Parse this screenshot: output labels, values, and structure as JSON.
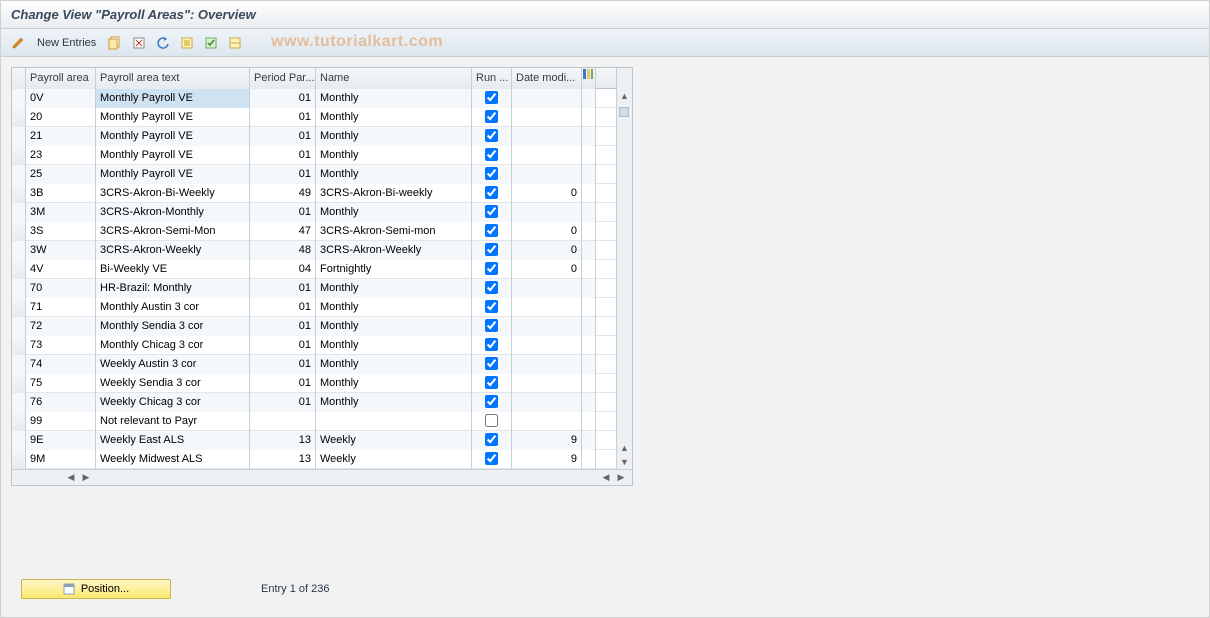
{
  "title": "Change View \"Payroll Areas\": Overview",
  "watermark": "www.tutorialkart.com",
  "toolbar": {
    "new_entries_label": "New Entries"
  },
  "columns": {
    "area": "Payroll area",
    "text": "Payroll area text",
    "period": "Period Par...",
    "name": "Name",
    "run": "Run ...",
    "date": "Date modi..."
  },
  "rows": [
    {
      "area": "0V",
      "text": "Monthly Payroll  VE",
      "period": "01",
      "name": "Monthly",
      "run": true,
      "date": ""
    },
    {
      "area": "20",
      "text": "Monthly Payroll  VE",
      "period": "01",
      "name": "Monthly",
      "run": true,
      "date": ""
    },
    {
      "area": "21",
      "text": "Monthly Payroll  VE",
      "period": "01",
      "name": "Monthly",
      "run": true,
      "date": ""
    },
    {
      "area": "23",
      "text": "Monthly Payroll  VE",
      "period": "01",
      "name": "Monthly",
      "run": true,
      "date": ""
    },
    {
      "area": "25",
      "text": "Monthly Payroll  VE",
      "period": "01",
      "name": "Monthly",
      "run": true,
      "date": ""
    },
    {
      "area": "3B",
      "text": "3CRS-Akron-Bi-Weekly",
      "period": "49",
      "name": "3CRS-Akron-Bi-weekly",
      "run": true,
      "date": "0"
    },
    {
      "area": "3M",
      "text": "3CRS-Akron-Monthly",
      "period": "01",
      "name": "Monthly",
      "run": true,
      "date": ""
    },
    {
      "area": "3S",
      "text": "3CRS-Akron-Semi-Mon",
      "period": "47",
      "name": "3CRS-Akron-Semi-mon",
      "run": true,
      "date": "0"
    },
    {
      "area": "3W",
      "text": "3CRS-Akron-Weekly",
      "period": "48",
      "name": "3CRS-Akron-Weekly",
      "run": true,
      "date": "0"
    },
    {
      "area": "4V",
      "text": "Bi-Weekly VE",
      "period": "04",
      "name": "Fortnightly",
      "run": true,
      "date": "0"
    },
    {
      "area": "70",
      "text": "HR-Brazil: Monthly",
      "period": "01",
      "name": "Monthly",
      "run": true,
      "date": ""
    },
    {
      "area": "71",
      "text": "Monthly Austin 3 cor",
      "period": "01",
      "name": "Monthly",
      "run": true,
      "date": ""
    },
    {
      "area": "72",
      "text": "Monthly Sendia 3 cor",
      "period": "01",
      "name": "Monthly",
      "run": true,
      "date": ""
    },
    {
      "area": "73",
      "text": "Monthly Chicag 3 cor",
      "period": "01",
      "name": "Monthly",
      "run": true,
      "date": ""
    },
    {
      "area": "74",
      "text": "Weekly Austin 3 cor",
      "period": "01",
      "name": "Monthly",
      "run": true,
      "date": ""
    },
    {
      "area": "75",
      "text": "Weekly Sendia 3 cor",
      "period": "01",
      "name": "Monthly",
      "run": true,
      "date": ""
    },
    {
      "area": "76",
      "text": "Weekly Chicag 3 cor",
      "period": "01",
      "name": "Monthly",
      "run": true,
      "date": ""
    },
    {
      "area": "99",
      "text": "Not relevant to Payr",
      "period": "",
      "name": "",
      "run": false,
      "date": ""
    },
    {
      "area": "9E",
      "text": "Weekly East ALS",
      "period": "13",
      "name": "Weekly",
      "run": true,
      "date": "9"
    },
    {
      "area": "9M",
      "text": "Weekly Midwest ALS",
      "period": "13",
      "name": "Weekly",
      "run": true,
      "date": "9"
    }
  ],
  "footer": {
    "position_label": "Position...",
    "entry_info": "Entry 1 of 236"
  }
}
